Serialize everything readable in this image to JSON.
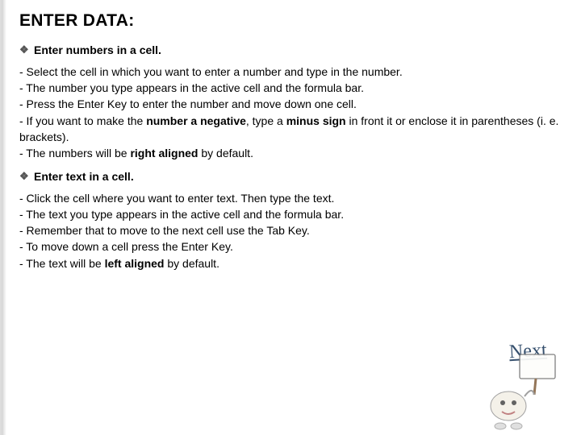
{
  "title": "ENTER DATA:",
  "section_numbers": {
    "heading": "Enter numbers in a cell.",
    "items": [
      "-  Select the cell in which you want to enter a number and type in the number.",
      "- The number you type appears in the active cell and the formula bar.",
      "- Press the Enter Key to enter the number and move down one cell.",
      {
        "pre": "- If you want to make the ",
        "b1": "number a negative",
        "mid": ", type a ",
        "b2": "minus sign",
        "post": " in front it or enclose it in parentheses (i. e. brackets)."
      },
      {
        "pre": "- The numbers will be ",
        "b1": "right aligned",
        "post": " by default."
      }
    ]
  },
  "section_text": {
    "heading": "Enter text in a cell.",
    "items": [
      "- Click the cell where you want to enter text. Then type the text.",
      "- The text you type appears in the active cell and the formula bar.",
      "- Remember that to move to the next cell use the Tab Key.",
      "- To move down a cell press the Enter Key.",
      {
        "pre": "- The text will be ",
        "b1": "left aligned",
        "post": " by default."
      }
    ]
  },
  "next_label": "Next",
  "icons": {
    "bullet": "❖"
  }
}
